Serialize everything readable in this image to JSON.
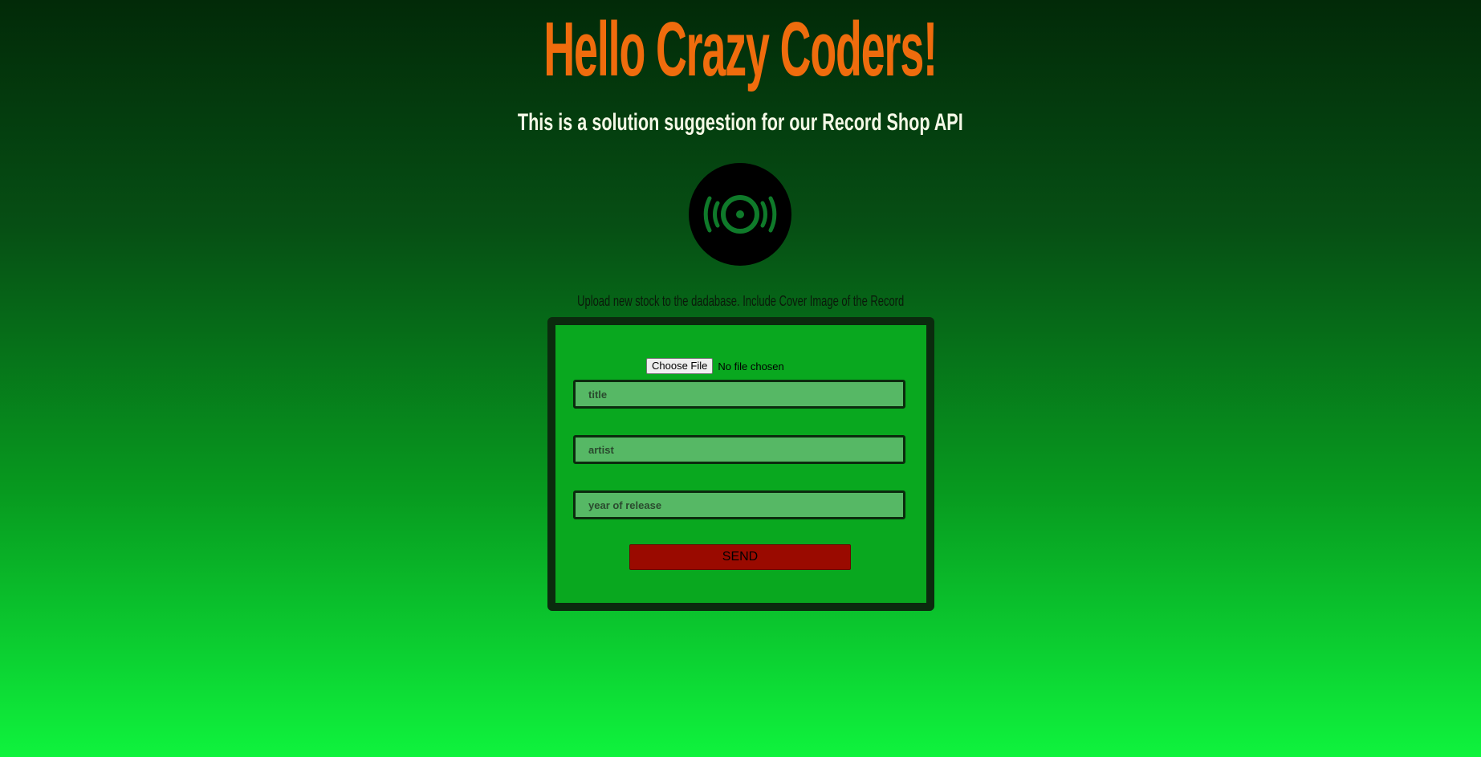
{
  "header": {
    "title": "Hello Crazy Coders!",
    "subtitle": "This is a solution suggestion for our Record Shop API"
  },
  "icons": {
    "record": "vinyl-record-icon"
  },
  "upload": {
    "label": "Upload new stock to the dadabase. Include Cover Image of the Record",
    "file_button_label": "Choose File",
    "file_status": "No file chosen",
    "fields": {
      "title_placeholder": "title",
      "artist_placeholder": "artist",
      "year_placeholder": "year of release"
    },
    "send_label": "SEND"
  },
  "colors": {
    "title": "#ef6c0d",
    "subtitle": "#f4f8e6",
    "form_background": "#09a81f",
    "form_border": "#0b2b0e",
    "input_background": "#56b865",
    "send_button": "#9a0a00"
  }
}
